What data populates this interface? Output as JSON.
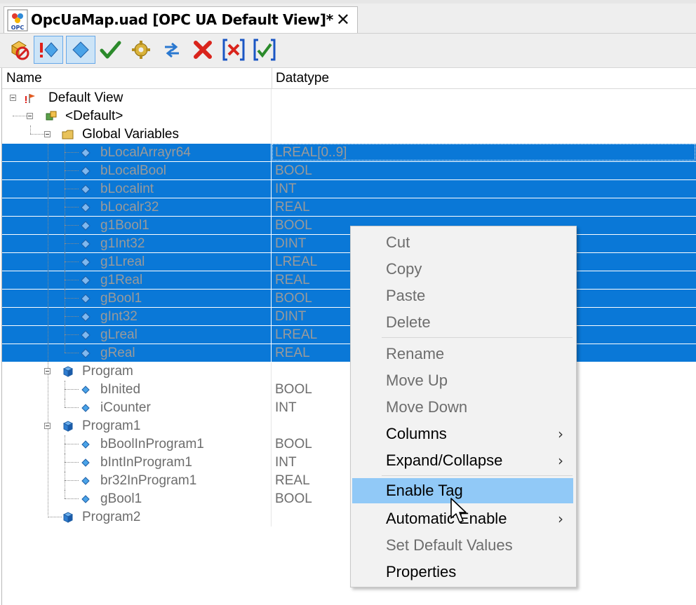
{
  "tab": {
    "title": "OpcUaMap.uad [OPC UA Default View]*",
    "close_glyph": "✕",
    "logo_text": "OPC"
  },
  "toolbar": {
    "buttons": [
      {
        "icon": "disable-tags-icon"
      },
      {
        "icon": "show-errors-icon",
        "active": true
      },
      {
        "icon": "show-tags-icon",
        "active": true
      },
      {
        "icon": "check-icon"
      },
      {
        "icon": "gear-icon"
      },
      {
        "icon": "sync-icon"
      },
      {
        "icon": "delete-icon"
      },
      {
        "icon": "uncheck-all-icon"
      },
      {
        "icon": "check-all-icon"
      }
    ]
  },
  "columns": {
    "name": "Name",
    "datatype": "Datatype"
  },
  "tree": {
    "default_view": "Default View",
    "default": "<Default>",
    "global_variables": "Global Variables",
    "globals": [
      {
        "name": "bLocalArrayr64",
        "type": "LREAL[0..9]"
      },
      {
        "name": "bLocalBool",
        "type": "BOOL"
      },
      {
        "name": "bLocalint",
        "type": "INT"
      },
      {
        "name": "bLocalr32",
        "type": "REAL"
      },
      {
        "name": "g1Bool1",
        "type": "BOOL"
      },
      {
        "name": "g1Int32",
        "type": "DINT"
      },
      {
        "name": "g1Lreal",
        "type": "LREAL"
      },
      {
        "name": "g1Real",
        "type": "REAL"
      },
      {
        "name": "gBool1",
        "type": "BOOL"
      },
      {
        "name": "gInt32",
        "type": "DINT"
      },
      {
        "name": "gLreal",
        "type": "LREAL"
      },
      {
        "name": "gReal",
        "type": "REAL"
      }
    ],
    "program": "Program",
    "program_vars": [
      {
        "name": "bInited",
        "type": "BOOL"
      },
      {
        "name": "iCounter",
        "type": "INT"
      }
    ],
    "program1": "Program1",
    "program1_vars": [
      {
        "name": "bBoolInProgram1",
        "type": "BOOL"
      },
      {
        "name": "bIntInProgram1",
        "type": "INT"
      },
      {
        "name": "br32InProgram1",
        "type": "REAL"
      },
      {
        "name": "gBool1",
        "type": "BOOL"
      }
    ],
    "program2": "Program2"
  },
  "context_menu": {
    "cut": "Cut",
    "copy": "Copy",
    "paste": "Paste",
    "delete": "Delete",
    "rename": "Rename",
    "move_up": "Move Up",
    "move_down": "Move Down",
    "columns": "Columns",
    "expand_collapse": "Expand/Collapse",
    "enable_tag": "Enable Tag",
    "automatic_enable": "Automatic Enable",
    "set_default_values": "Set Default Values",
    "properties": "Properties",
    "submenu_arrow": "›"
  },
  "colors": {
    "selection": "#0a78d7",
    "menu_hover": "#91c9f7",
    "accent": "#66a7e8"
  }
}
